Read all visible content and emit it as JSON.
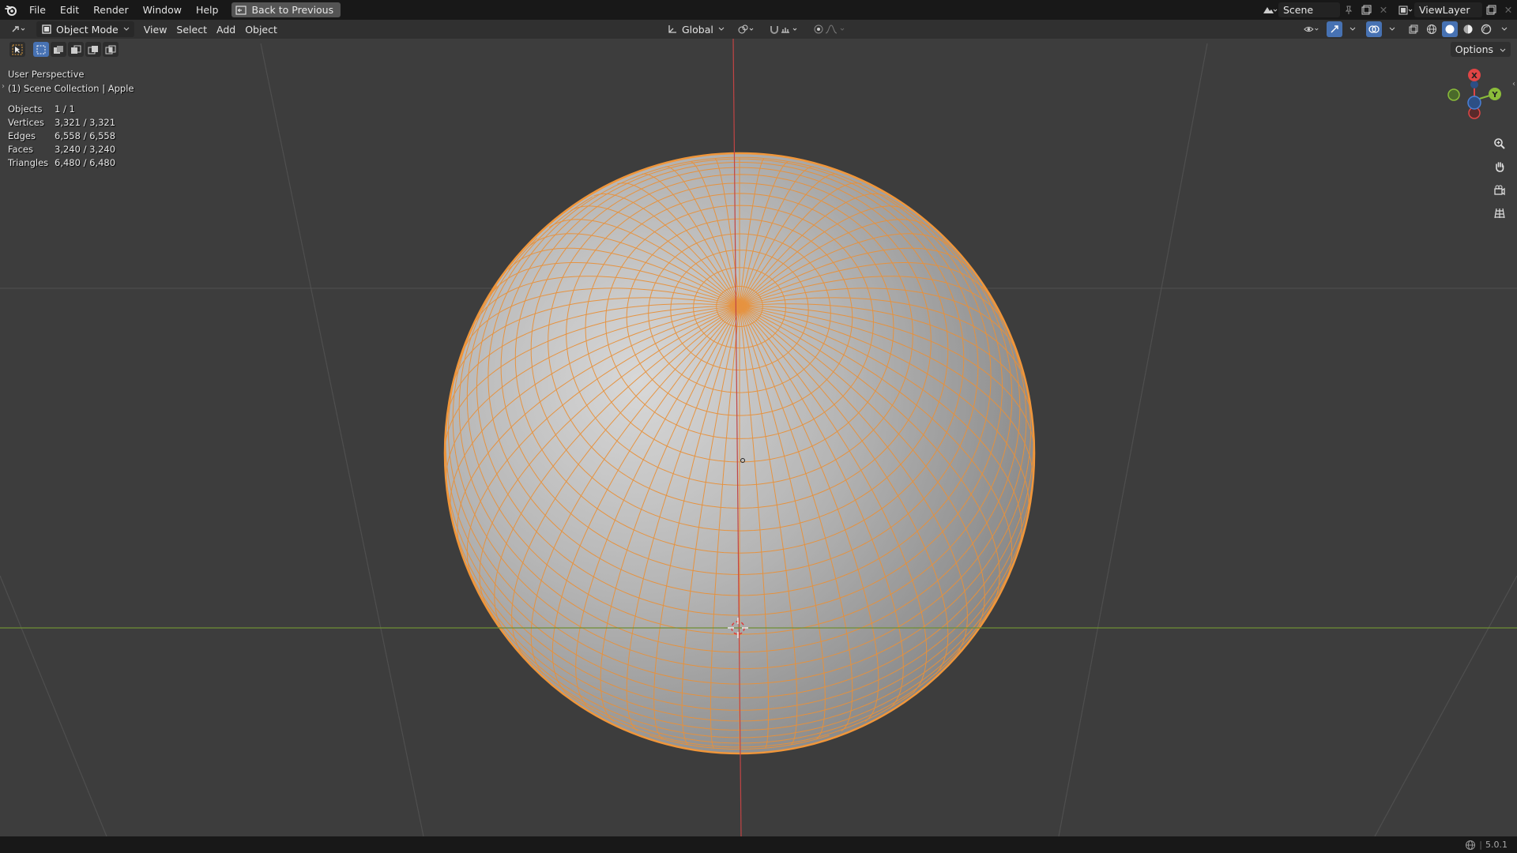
{
  "menubar": {
    "items": [
      "File",
      "Edit",
      "Render",
      "Window",
      "Help"
    ],
    "back_button": "Back to Previous",
    "scene_name": "Scene",
    "view_layer": "ViewLayer"
  },
  "viewport_header": {
    "mode": "Object Mode",
    "menus": [
      "View",
      "Select",
      "Add",
      "Object"
    ],
    "transform_orientation": "Global",
    "options_label": "Options"
  },
  "overlay": {
    "perspective": "User Perspective",
    "collection": "(1) Scene Collection | Apple",
    "stats": [
      {
        "label": "Objects",
        "value": "1 / 1"
      },
      {
        "label": "Vertices",
        "value": "3,321 / 3,321"
      },
      {
        "label": "Edges",
        "value": "6,558 / 6,558"
      },
      {
        "label": "Faces",
        "value": "3,240 / 3,240"
      },
      {
        "label": "Triangles",
        "value": "6,480 / 6,480"
      }
    ]
  },
  "gizmo": {
    "x_label": "X",
    "y_label": "Y"
  },
  "statusbar": {
    "version": "5.0.1"
  },
  "colors": {
    "accent": "#4772b3",
    "selection_outline": "#f0963a",
    "axis_x": "#e04545",
    "axis_y": "#8bbd3a",
    "axis_z": "#4a80d8"
  }
}
